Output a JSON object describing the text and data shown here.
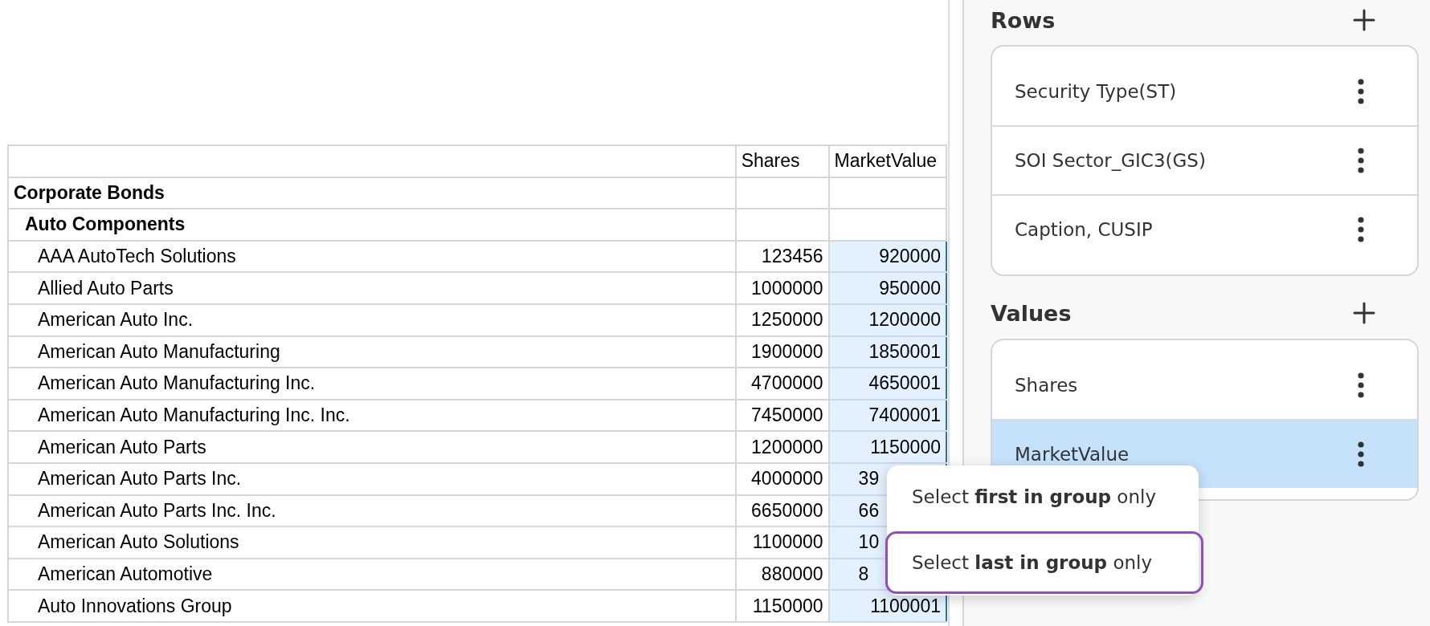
{
  "table": {
    "columns": [
      {
        "label": "Shares"
      },
      {
        "label": "MarketValue"
      }
    ],
    "rows": [
      {
        "kind": "group",
        "label": "Corporate Bonds",
        "children": [
          {
            "kind": "group",
            "label": "Auto Components",
            "children": [
              {
                "kind": "item",
                "label": "AAA AutoTech Solutions",
                "shares": "123456",
                "market_value": "920000",
                "market_value_selected": true,
                "covered": false
              },
              {
                "kind": "item",
                "label": "Allied Auto Parts",
                "shares": "1000000",
                "market_value": "950000",
                "market_value_selected": true,
                "covered": false
              },
              {
                "kind": "item",
                "label": "American Auto Inc.",
                "shares": "1250000",
                "market_value": "1200000",
                "market_value_selected": true,
                "covered": false
              },
              {
                "kind": "item",
                "label": "American Auto Manufacturing",
                "shares": "1900000",
                "market_value": "1850001",
                "market_value_selected": true,
                "covered": false
              },
              {
                "kind": "item",
                "label": "American Auto Manufacturing Inc.",
                "shares": "4700000",
                "market_value": "4650001",
                "market_value_selected": true,
                "covered": false
              },
              {
                "kind": "item",
                "label": "American Auto Manufacturing Inc. Inc.",
                "shares": "7450000",
                "market_value": "7400001",
                "market_value_selected": true,
                "covered": false
              },
              {
                "kind": "item",
                "label": "American Auto Parts",
                "shares": "1200000",
                "market_value": "1150000",
                "market_value_selected": true,
                "covered": false
              },
              {
                "kind": "item",
                "label": "American Auto Parts Inc.",
                "shares": "4000000",
                "market_value": "39",
                "market_value_selected": true,
                "covered": true
              },
              {
                "kind": "item",
                "label": "American Auto Parts Inc. Inc.",
                "shares": "6650000",
                "market_value": "66",
                "market_value_selected": true,
                "covered": true
              },
              {
                "kind": "item",
                "label": "American Auto Solutions",
                "shares": "1100000",
                "market_value": "10",
                "market_value_selected": true,
                "covered": true
              },
              {
                "kind": "item",
                "label": "American Automotive",
                "shares": "880000",
                "market_value": "8",
                "market_value_selected": true,
                "covered": true
              },
              {
                "kind": "item",
                "label": "Auto Innovations Group",
                "shares": "1150000",
                "market_value": "1100001",
                "market_value_selected": true,
                "covered": false
              }
            ]
          }
        ]
      }
    ]
  },
  "sections": [
    {
      "title": "Rows",
      "fields": [
        {
          "label": "Security Type(ST)",
          "selected": false
        },
        {
          "label": "SOI Sector_GIC3(GS)",
          "selected": false
        },
        {
          "label": "Caption, CUSIP",
          "selected": false
        }
      ]
    },
    {
      "title": "Values",
      "fields": [
        {
          "label": "Shares",
          "selected": false
        },
        {
          "label": "MarketValue",
          "selected": true
        }
      ]
    }
  ],
  "menu": {
    "items": [
      {
        "label": "Select **first in group** only",
        "selected": false
      },
      {
        "label": "Select **last in group** only",
        "selected": true
      }
    ]
  }
}
